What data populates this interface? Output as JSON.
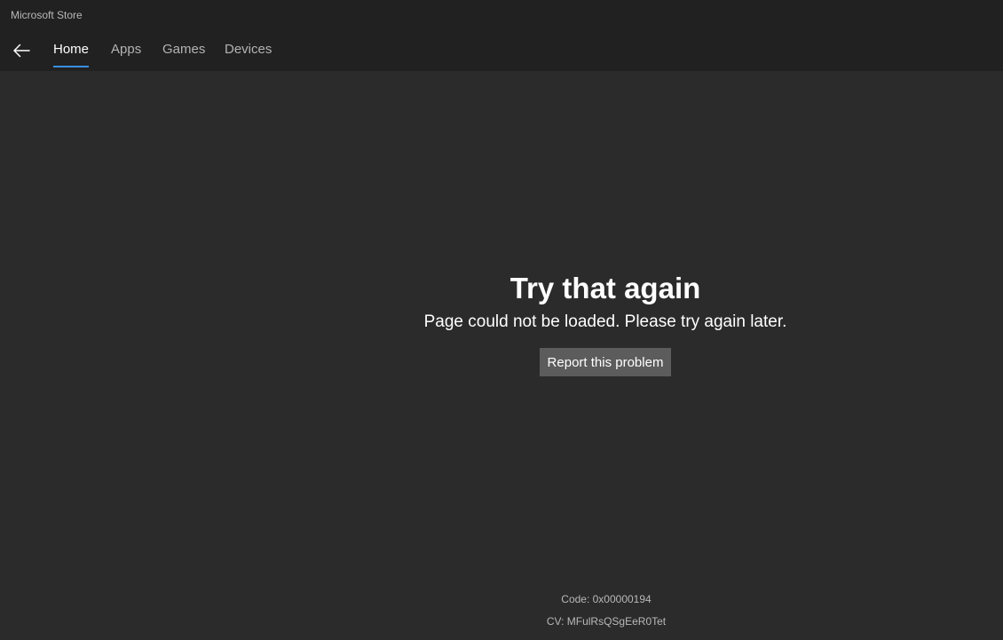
{
  "window": {
    "title": "Microsoft Store"
  },
  "nav": {
    "back_icon": "back-arrow-icon",
    "tabs": [
      {
        "label": "Home",
        "active": true
      },
      {
        "label": "Apps",
        "active": false
      },
      {
        "label": "Games",
        "active": false
      },
      {
        "label": "Devices",
        "active": false
      }
    ],
    "accent_color": "#3a8fe0"
  },
  "error": {
    "title": "Try that again",
    "message": "Page could not be loaded. Please try again later.",
    "report_label": "Report this problem"
  },
  "footer": {
    "code": "Code: 0x00000194",
    "cv": "CV: MFulRsQSgEeR0Tet"
  },
  "colors": {
    "background": "#2b2b2b",
    "header": "#212121",
    "button": "#5c5c5c"
  }
}
